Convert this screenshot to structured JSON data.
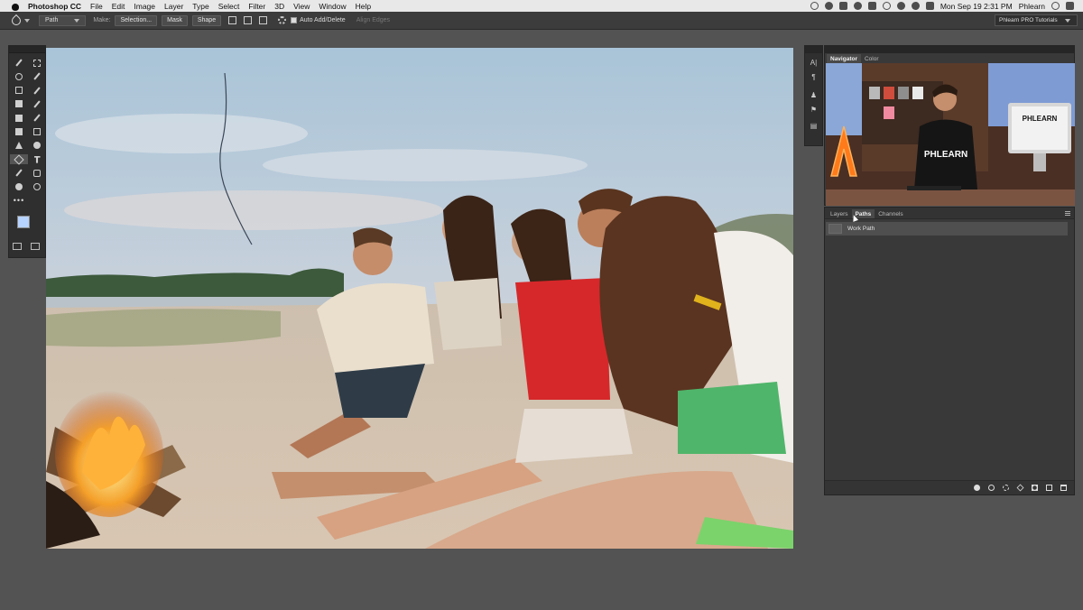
{
  "menubar": {
    "app_name": "Photoshop CC",
    "menus": [
      "File",
      "Edit",
      "Image",
      "Layer",
      "Type",
      "Select",
      "Filter",
      "3D",
      "View",
      "Window",
      "Help"
    ],
    "datetime": "Mon Sep 19  2:31 PM",
    "user": "Phlearn"
  },
  "options": {
    "mode": "Path",
    "make_label": "Make:",
    "selection_button": "Selection...",
    "mask_button": "Mask",
    "shape_button": "Shape",
    "auto_add_delete": "Auto Add/Delete",
    "auto_add_delete_checked": true,
    "align_edges": "Align Edges",
    "workspace": "Phlearn PRO Tutorials"
  },
  "tools": {
    "foreground_color": "#b7d3ff",
    "background_color": "#000000"
  },
  "navigator": {
    "tabs": [
      "Navigator",
      "Color"
    ],
    "active_tab": "Navigator"
  },
  "paths_panel": {
    "tabs": [
      "Layers",
      "Paths",
      "Channels"
    ],
    "active_tab": "Paths",
    "items": [
      {
        "label": "Work Path"
      }
    ]
  },
  "colors": {
    "app_bg": "#535353",
    "panel_bg": "#393939",
    "selected_row": "#4f4f4f"
  }
}
